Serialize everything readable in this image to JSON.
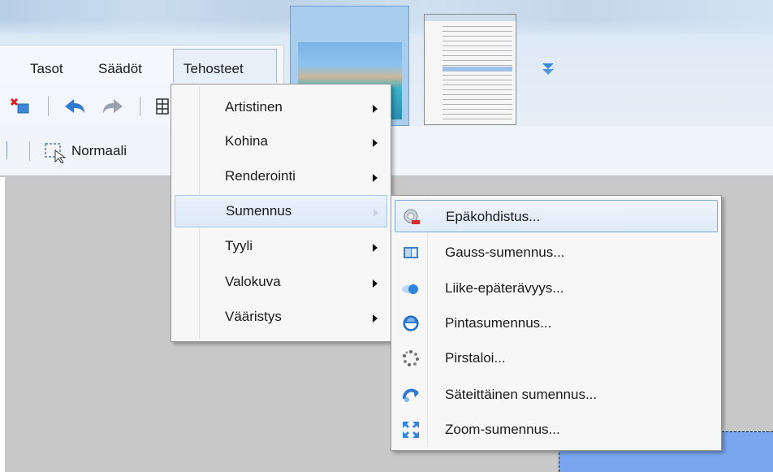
{
  "menubar": {
    "items": [
      {
        "label": "Tasot"
      },
      {
        "label": "Säädöt"
      },
      {
        "label": "Tehosteet"
      }
    ]
  },
  "toolbar": {
    "zoom_mode_label": "Normaali"
  },
  "effects_menu": {
    "items": [
      {
        "label": "Artistinen",
        "has_submenu": true
      },
      {
        "label": "Kohina",
        "has_submenu": true
      },
      {
        "label": "Renderointi",
        "has_submenu": true
      },
      {
        "label": "Sumennus",
        "has_submenu": true,
        "highlighted": true
      },
      {
        "label": "Tyyli",
        "has_submenu": true
      },
      {
        "label": "Valokuva",
        "has_submenu": true
      },
      {
        "label": "Vääristys",
        "has_submenu": true
      }
    ]
  },
  "blur_submenu": {
    "items": [
      {
        "label": "Epäkohdistus...",
        "icon": "unfocus-icon",
        "highlighted": true
      },
      {
        "label": "Gauss-sumennus...",
        "icon": "gaussian-blur-icon"
      },
      {
        "label": "Liike-epäterävyys...",
        "icon": "motion-blur-icon"
      },
      {
        "label": "Pintasumennus...",
        "icon": "surface-blur-icon"
      },
      {
        "label": "Pirstaloi...",
        "icon": "fragment-icon"
      },
      {
        "label": "Säteittäinen sumennus...",
        "icon": "radial-blur-icon"
      },
      {
        "label": "Zoom-sumennus...",
        "icon": "zoom-blur-icon"
      }
    ]
  },
  "colors": {
    "highlight_border": "#7fa9d8",
    "menu_bg": "#f7f7f7",
    "canvas_bg": "#c8c8c8",
    "selection_fill": "#79a6ee"
  }
}
